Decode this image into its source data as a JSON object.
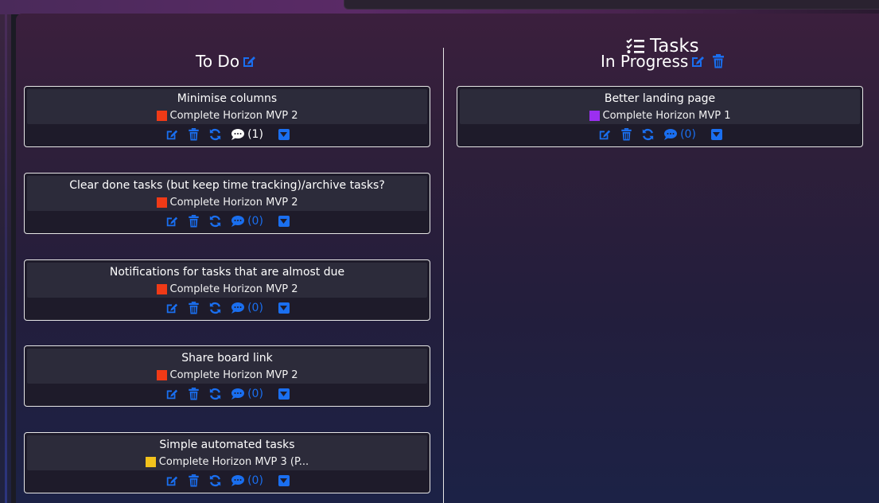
{
  "board": {
    "title": "Tasks"
  },
  "columns": [
    {
      "name": "To Do"
    },
    {
      "name": "In Progress"
    }
  ],
  "colors": {
    "accent": "#1a6ff0",
    "red": "#f03a17",
    "purple": "#9b2ff0",
    "yellow": "#f2c21c"
  },
  "todo_cards": [
    {
      "title": "Minimise columns",
      "label": "Complete Horizon MVP 2",
      "label_color": "#f03a17",
      "comments": "(1)"
    },
    {
      "title": "Clear done tasks (but keep time tracking)/archive tasks?",
      "label": "Complete Horizon MVP 2",
      "label_color": "#f03a17",
      "comments": "(0)"
    },
    {
      "title": "Notifications for tasks that are almost due",
      "label": "Complete Horizon MVP 2",
      "label_color": "#f03a17",
      "comments": "(0)"
    },
    {
      "title": "Share board link",
      "label": "Complete Horizon MVP 2",
      "label_color": "#f03a17",
      "comments": "(0)"
    },
    {
      "title": "Simple automated tasks",
      "label": "Complete Horizon MVP 3 (P...",
      "label_color": "#f2c21c",
      "comments": "(0)"
    }
  ],
  "inprogress_cards": [
    {
      "title": "Better landing page",
      "label": "Complete Horizon MVP 1",
      "label_color": "#9b2ff0",
      "comments": "(0)"
    }
  ],
  "icons": [
    "tasks-icon",
    "edit-icon",
    "trash-icon",
    "refresh-icon",
    "comment-icon",
    "caret-down-icon"
  ]
}
